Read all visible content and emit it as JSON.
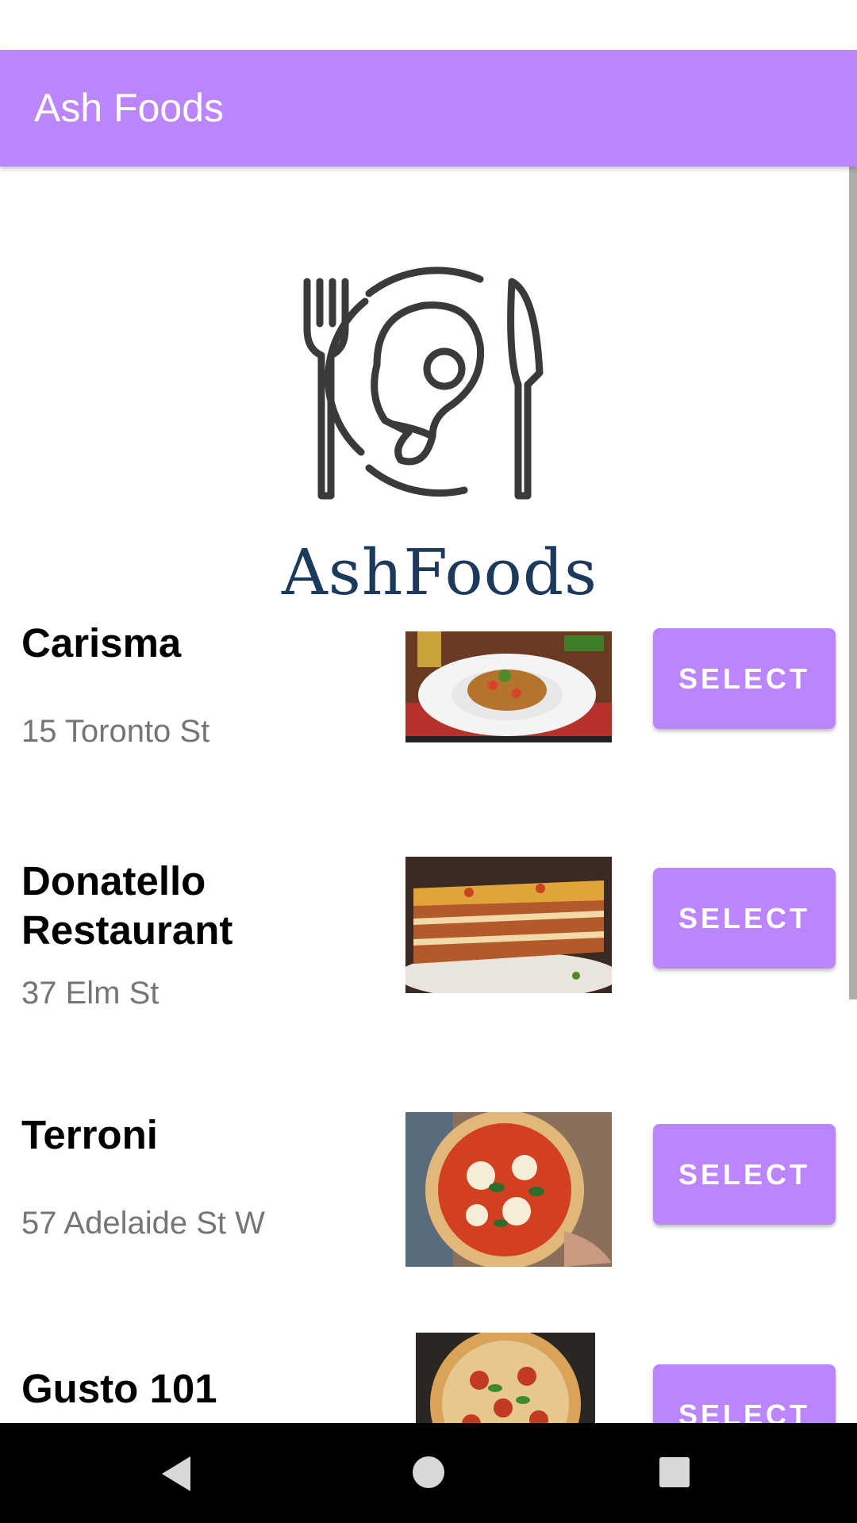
{
  "app": {
    "title": "Ash Foods",
    "accent_color": "#bb86fc",
    "logo_text": "AshFoods",
    "logo_icon": "plate-fork-knife-icon"
  },
  "restaurants": [
    {
      "name": "Carisma",
      "address": "15 Toronto St",
      "button_label": "SELECT",
      "image": "spaghetti-dish-photo"
    },
    {
      "name": "Donatello Restaurant",
      "address": "37 Elm St",
      "button_label": "SELECT",
      "image": "lasagna-photo"
    },
    {
      "name": "Terroni",
      "address": "57 Adelaide St W",
      "button_label": "SELECT",
      "image": "margherita-pizza-photo"
    },
    {
      "name": "Gusto 101",
      "address": "",
      "button_label": "SELECT",
      "image": "pepperoni-pizza-photo"
    }
  ],
  "nav": {
    "back_icon": "back-triangle-icon",
    "home_icon": "home-circle-icon",
    "recents_icon": "recents-square-icon"
  }
}
